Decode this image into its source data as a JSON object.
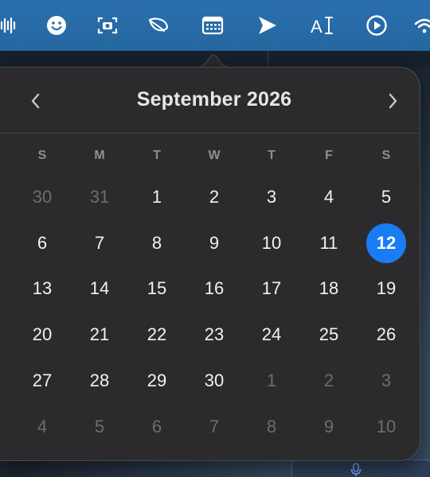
{
  "menubar": {
    "icons": [
      {
        "name": "audio-waveform-icon"
      },
      {
        "name": "smiley-face-icon"
      },
      {
        "name": "screenshot-camera-icon"
      },
      {
        "name": "leaf-icon"
      },
      {
        "name": "calendar-icon"
      },
      {
        "name": "send-arrow-icon"
      },
      {
        "name": "text-cursor-icon"
      },
      {
        "name": "play-circle-icon"
      },
      {
        "name": "wifi-icon"
      }
    ]
  },
  "calendar": {
    "month_title": "September 2026",
    "prev_label": "‹",
    "next_label": "›",
    "weekdays": [
      "S",
      "M",
      "T",
      "W",
      "T",
      "F",
      "S"
    ],
    "weeks": [
      [
        {
          "d": "30",
          "muted": true
        },
        {
          "d": "31",
          "muted": true
        },
        {
          "d": "1"
        },
        {
          "d": "2"
        },
        {
          "d": "3"
        },
        {
          "d": "4"
        },
        {
          "d": "5"
        }
      ],
      [
        {
          "d": "6"
        },
        {
          "d": "7"
        },
        {
          "d": "8"
        },
        {
          "d": "9"
        },
        {
          "d": "10"
        },
        {
          "d": "11"
        },
        {
          "d": "12",
          "today": true
        }
      ],
      [
        {
          "d": "13"
        },
        {
          "d": "14"
        },
        {
          "d": "15"
        },
        {
          "d": "16"
        },
        {
          "d": "17"
        },
        {
          "d": "18"
        },
        {
          "d": "19"
        }
      ],
      [
        {
          "d": "20"
        },
        {
          "d": "21"
        },
        {
          "d": "22"
        },
        {
          "d": "23"
        },
        {
          "d": "24"
        },
        {
          "d": "25"
        },
        {
          "d": "26"
        }
      ],
      [
        {
          "d": "27"
        },
        {
          "d": "28"
        },
        {
          "d": "29"
        },
        {
          "d": "30"
        },
        {
          "d": "1",
          "muted": true
        },
        {
          "d": "2",
          "muted": true
        },
        {
          "d": "3",
          "muted": true
        }
      ],
      [
        {
          "d": "4",
          "muted": true
        },
        {
          "d": "5",
          "muted": true
        },
        {
          "d": "6",
          "muted": true
        },
        {
          "d": "7",
          "muted": true
        },
        {
          "d": "8",
          "muted": true
        },
        {
          "d": "9",
          "muted": true
        },
        {
          "d": "10",
          "muted": true
        }
      ]
    ]
  },
  "colors": {
    "accent": "#1a7cf5",
    "menubar": "#2a6fae",
    "popover_bg": "#2b2b2d"
  }
}
